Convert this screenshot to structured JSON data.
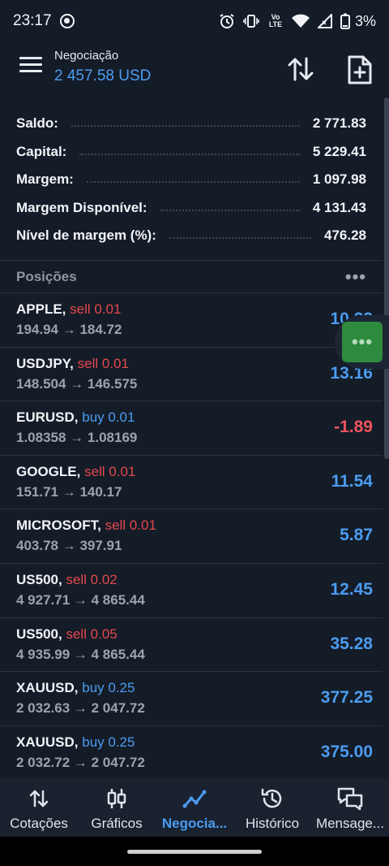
{
  "status_bar": {
    "time": "23:17",
    "network_label": "Vo LTE",
    "battery": "3%"
  },
  "header": {
    "title": "Negociação",
    "subtitle": "2 457.58 USD",
    "icons": [
      "menu-icon",
      "sort-icon",
      "new-document-icon"
    ]
  },
  "summary": [
    {
      "label": "Saldo:",
      "value": "2 771.83"
    },
    {
      "label": "Capital:",
      "value": "5 229.41"
    },
    {
      "label": "Margem:",
      "value": "1 097.98"
    },
    {
      "label": "Margem Disponível:",
      "value": "4 131.43"
    },
    {
      "label": "Nível de margem (%):",
      "value": "476.28"
    }
  ],
  "positions": {
    "title": "Posições",
    "more": "•••",
    "items": [
      {
        "symbol": "APPLE,",
        "side": "sell 0.01",
        "side_type": "sell",
        "prices": "194.94 → 184.72",
        "profit": "10.22",
        "profit_type": "pos"
      },
      {
        "symbol": "USDJPY,",
        "side": "sell 0.01",
        "side_type": "sell",
        "prices": "148.504 → 146.575",
        "profit": "13.16",
        "profit_type": "pos"
      },
      {
        "symbol": "EURUSD,",
        "side": "buy 0.01",
        "side_type": "buy",
        "prices": "1.08358 → 1.08169",
        "profit": "-1.89",
        "profit_type": "neg"
      },
      {
        "symbol": "GOOGLE,",
        "side": "sell 0.01",
        "side_type": "sell",
        "prices": "151.71 → 140.17",
        "profit": "11.54",
        "profit_type": "pos"
      },
      {
        "symbol": "MICROSOFT,",
        "side": "sell 0.01",
        "side_type": "sell",
        "prices": "403.78 → 397.91",
        "profit": "5.87",
        "profit_type": "pos"
      },
      {
        "symbol": "US500,",
        "side": "sell 0.02",
        "side_type": "sell",
        "prices": "4 927.71 → 4 865.44",
        "profit": "12.45",
        "profit_type": "pos"
      },
      {
        "symbol": "US500,",
        "side": "sell 0.05",
        "side_type": "sell",
        "prices": "4 935.99 → 4 865.44",
        "profit": "35.28",
        "profit_type": "pos"
      },
      {
        "symbol": "XAUUSD,",
        "side": "buy 0.25",
        "side_type": "buy",
        "prices": "2 032.63 → 2 047.72",
        "profit": "377.25",
        "profit_type": "pos"
      },
      {
        "symbol": "XAUUSD,",
        "side": "buy 0.25",
        "side_type": "buy",
        "prices": "2 032.72 → 2 047.72",
        "profit": "375.00",
        "profit_type": "pos"
      }
    ]
  },
  "fab": {
    "label": "•••"
  },
  "bottom_nav": [
    {
      "label": "Cotações",
      "icon": "quotes-icon",
      "active": false
    },
    {
      "label": "Gráficos",
      "icon": "charts-icon",
      "active": false
    },
    {
      "label": "Negocia...",
      "icon": "trade-icon",
      "active": true
    },
    {
      "label": "Histórico",
      "icon": "history-icon",
      "active": false
    },
    {
      "label": "Mensage...",
      "icon": "messages-icon",
      "active": false
    }
  ],
  "colors": {
    "background": "#141c28",
    "accent": "#4c9cf0",
    "sell": "#e5484d",
    "negative": "#f0545d",
    "fab": "#2e8b3e"
  }
}
